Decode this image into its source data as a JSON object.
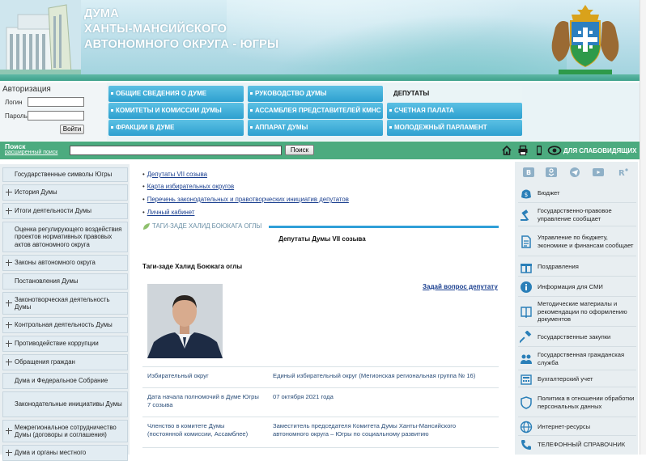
{
  "header": {
    "title_lines": [
      "ДУМА",
      "ХАНТЫ-МАНСИЙСКОГО",
      "АВТОНОМНОГО ОКРУГА - ЮГРЫ"
    ]
  },
  "auth": {
    "title": "Авторизация",
    "login_label": "Логин",
    "password_label": "Пароль",
    "login_value": "",
    "password_value": "",
    "submit_label": "Войти"
  },
  "topmenu": [
    "ОБЩИЕ СВЕДЕНИЯ О ДУМЕ",
    "РУКОВОДСТВО ДУМЫ",
    "ДЕПУТАТЫ",
    "КОМИТЕТЫ И КОМИССИИ ДУМЫ",
    "АССАМБЛЕЯ ПРЕДСТАВИТЕЛЕЙ КМНС",
    "СЧЕТНАЯ ПАЛАТА",
    "ФРАКЦИИ В ДУМЕ",
    "АППАРАТ ДУМЫ",
    "МОЛОДЕЖНЫЙ ПАРЛАМЕНТ"
  ],
  "topmenu_active": "ДЕПУТАТЫ",
  "search": {
    "label": "Поиск",
    "advanced_link": "расширенный поиск",
    "query": "",
    "button_label": "Поиск",
    "low_vision_label": "ДЛЯ СЛАБОВИДЯЩИХ"
  },
  "leftmenu": [
    {
      "label": "Государственные символы Югры",
      "expandable": false
    },
    {
      "label": "История Думы",
      "expandable": true
    },
    {
      "label": "Итоги деятельности Думы",
      "expandable": true
    },
    {
      "label": "Оценка регулирующего воздействия проектов нормативных правовых актов автономного округа",
      "expandable": false
    },
    {
      "label": "Законы автономного округа",
      "expandable": true
    },
    {
      "label": "Постановления Думы",
      "expandable": false
    },
    {
      "label": "Законотворческая деятельность Думы",
      "expandable": true
    },
    {
      "label": "Контрольная деятельность Думы",
      "expandable": true
    },
    {
      "label": "Противодействие коррупции",
      "expandable": true
    },
    {
      "label": "Обращения граждан",
      "expandable": true
    },
    {
      "label": "Дума и Федеральное Собрание",
      "expandable": false
    },
    {
      "label": "Законодательные инициативы Думы",
      "expandable": false
    },
    {
      "label": "Межрегиональное сотрудничество Думы (договоры и соглашения)",
      "expandable": true
    },
    {
      "label": "Дума и органы местного",
      "expandable": true
    }
  ],
  "center": {
    "quick_links": [
      "Депутаты VII созыва",
      "Карта избирательных округов",
      "Перечень законодательных и правотворческих инициатив депутатов",
      "Личный кабинет"
    ],
    "section_tag": "ТАГИ-ЗАДЕ ХАЛИД БОЮКАГА ОГЛЫ",
    "heading": "Депутаты Думы VII созыва",
    "deputy_name": "Таги-заде Халид Боюкага оглы",
    "ask_question_link": "Задай вопрос депутату",
    "details": [
      {
        "key": "Избирательный округ",
        "value": "Единый избирательный округ (Мегионская региональная группа № 16)"
      },
      {
        "key": "Дата начала полномочий в Думе Югры 7 созыва",
        "value": "07 октября 2021 года"
      },
      {
        "key": "Членство в комитете Думы (постоянной комиссии, Ассамблее)",
        "value": "Заместитель председателя Комитета Думы Ханты-Мансийского автономного округа – Югры по социальному развитию"
      }
    ]
  },
  "rightcol": [
    {
      "label": "Бюджет",
      "icon": "budget-icon"
    },
    {
      "label": "Государственно-правовое управление сообщает",
      "icon": "gavel-icon"
    },
    {
      "label": "Управление по бюджету, экономике и финансам сообщает",
      "icon": "document-icon"
    },
    {
      "label": "Поздравления",
      "icon": "gift-icon"
    },
    {
      "label": "Информация для СМИ",
      "icon": "info-icon"
    },
    {
      "label": "Методические материалы и рекомендации по оформлению документов",
      "icon": "book-icon"
    },
    {
      "label": "Государственные закупки",
      "icon": "hammer-icon"
    },
    {
      "label": "Государственная гражданская служба",
      "icon": "people-icon"
    },
    {
      "label": "Бухгалтерский учет",
      "icon": "calculator-icon"
    },
    {
      "label": "Политика в отношении обработки персональных данных",
      "icon": "shield-icon"
    },
    {
      "label": "Интернет-ресурсы",
      "icon": "globe-icon"
    },
    {
      "label": "ТЕЛЕФОННЫЙ СПРАВОЧНИК",
      "icon": "phone-icon"
    }
  ],
  "colors": {
    "menu_blue": "#2ea0d0",
    "search_green": "#4cab7f",
    "link_blue": "#1a3f8f",
    "section_bar": "#2f9fd8"
  }
}
